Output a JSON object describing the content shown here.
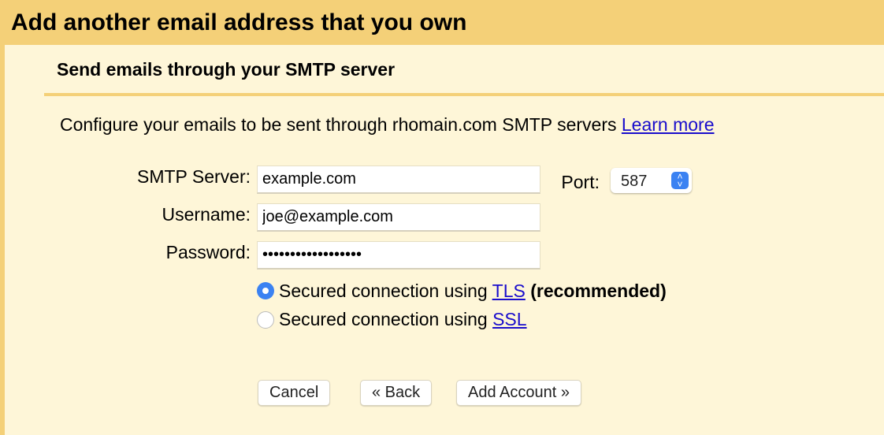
{
  "header": {
    "title": "Add another email address that you own"
  },
  "section": {
    "title": "Send emails through your SMTP server"
  },
  "description": {
    "text": "Configure your emails to be sent through rhomain.com SMTP servers ",
    "link": "Learn more"
  },
  "form": {
    "smtp_label": "SMTP Server:",
    "smtp_value": "example.com",
    "port_label": "Port:",
    "port_value": "587",
    "username_label": "Username:",
    "username_value": "joe@example.com",
    "password_label": "Password:",
    "password_value": "••••••••••••••••••"
  },
  "security": {
    "options": [
      {
        "text": "Secured connection using ",
        "link": "TLS",
        "suffix": " (recommended)",
        "selected": true
      },
      {
        "text": "Secured connection using ",
        "link": "SSL",
        "suffix": "",
        "selected": false
      }
    ]
  },
  "buttons": {
    "cancel": "Cancel",
    "back": "« Back",
    "add": "Add Account »"
  },
  "colors": {
    "header_bg": "#f4d078",
    "panel_bg": "#fef6d8",
    "link": "#1a0dcc",
    "accent": "#3b82f2"
  }
}
